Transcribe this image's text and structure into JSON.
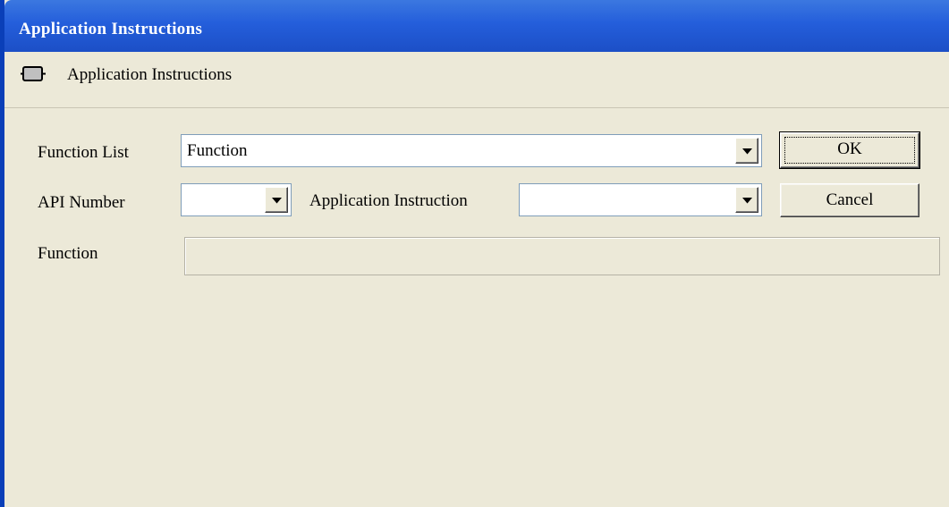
{
  "window": {
    "title": "Application Instructions"
  },
  "header": {
    "icon": "instruction-block-icon",
    "text": "Application Instructions"
  },
  "form": {
    "function_list": {
      "label": "Function List",
      "value": "Function"
    },
    "api_number": {
      "label": "API Number",
      "value": ""
    },
    "application_instruction": {
      "label": "Application Instruction",
      "value": ""
    },
    "function": {
      "label": "Function",
      "value": ""
    }
  },
  "buttons": {
    "ok": "OK",
    "cancel": "Cancel"
  },
  "colors": {
    "title_bar": "#245edb",
    "dialog_background": "#ece9d8",
    "input_border": "#7f9db9"
  }
}
